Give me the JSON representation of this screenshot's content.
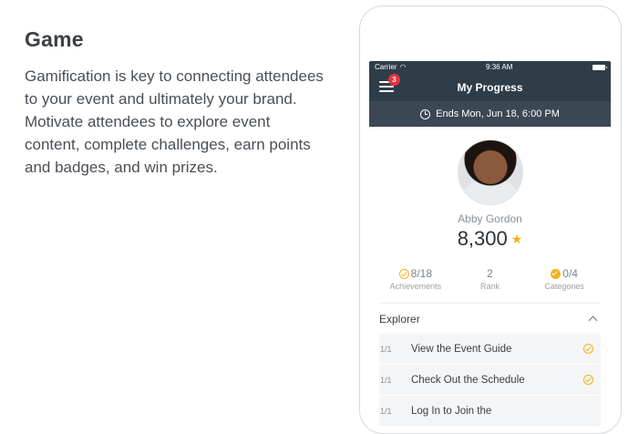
{
  "left": {
    "heading": "Game",
    "body": "Gamification is key to connecting attendees to your event and ultimately your brand. Motivate attendees to explore event content, complete challenges, earn points and badges, and win prizes."
  },
  "status": {
    "carrier": "Carrier",
    "time": "9:36 AM"
  },
  "nav": {
    "title": "My Progress",
    "badge": "3"
  },
  "sub": {
    "ends": "Ends Mon, Jun 18, 6:00 PM"
  },
  "profile": {
    "name": "Abby Gordon",
    "points": "8,300"
  },
  "stats": [
    {
      "value": "8/18",
      "label": "Achievements"
    },
    {
      "value": "2",
      "label": "Rank"
    },
    {
      "value": "0/4",
      "label": "Categories"
    }
  ],
  "section": {
    "title": "Explorer"
  },
  "tasks": [
    {
      "frac": "1/1",
      "label": "View the Event Guide"
    },
    {
      "frac": "1/1",
      "label": "Check Out the Schedule"
    },
    {
      "frac": "1/1",
      "label": "Log In to Join the"
    }
  ],
  "colors": {
    "navbar": "#2f3d49",
    "accent": "#f2b21b",
    "badge": "#e5333f"
  }
}
